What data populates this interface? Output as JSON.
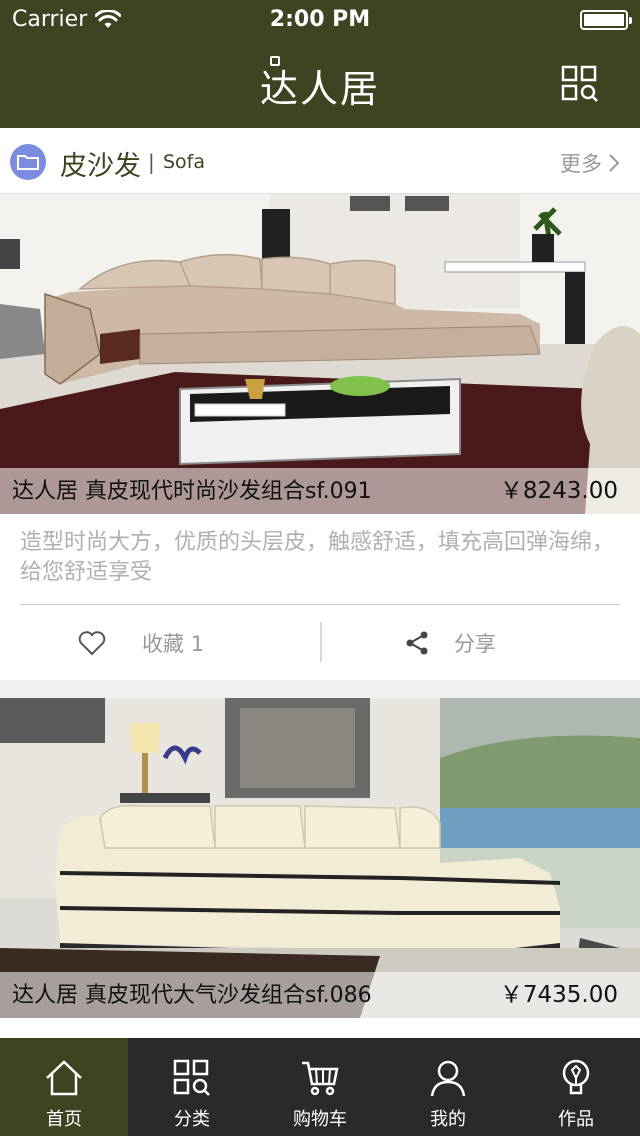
{
  "status_bar": {
    "carrier": "Carrier",
    "time": "2:00 PM"
  },
  "nav": {
    "logo_text": "达人居"
  },
  "section": {
    "title": "皮沙发",
    "separator": "|",
    "subtitle": "Sofa",
    "more_label": "更多"
  },
  "products": [
    {
      "name": "达人居 真皮现代时尚沙发组合sf.091",
      "price": "￥8243.00",
      "description": "造型时尚大方，优质的头层皮，触感舒适，填充高回弹海绵，给您舒适享受",
      "favorite_label": "收藏",
      "favorite_count": "1",
      "share_label": "分享"
    },
    {
      "name": "达人居 真皮现代大气沙发组合sf.086",
      "price": "￥7435.00"
    }
  ],
  "tabs": [
    {
      "label": "首页",
      "icon": "home-icon",
      "active": true
    },
    {
      "label": "分类",
      "icon": "category-icon",
      "active": false
    },
    {
      "label": "购物车",
      "icon": "cart-icon",
      "active": false
    },
    {
      "label": "我的",
      "icon": "user-icon",
      "active": false
    },
    {
      "label": "作品",
      "icon": "works-icon",
      "active": false
    }
  ],
  "colors": {
    "brand": "#3c4421",
    "tabbar_bg": "#2a2a2a",
    "muted_text": "#999999",
    "category_icon_bg": "#7d8be0"
  }
}
